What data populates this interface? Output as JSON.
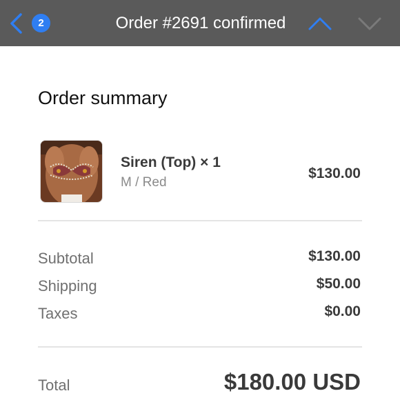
{
  "header": {
    "badge_count": "2",
    "title": "Order #2691 confirmed"
  },
  "summary": {
    "title": "Order summary"
  },
  "item": {
    "name": "Siren (Top) × 1",
    "variant": "M / Red",
    "price": "$130.00"
  },
  "totals": {
    "subtotal_label": "Subtotal",
    "subtotal_value": "$130.00",
    "shipping_label": "Shipping",
    "shipping_value": "$50.00",
    "taxes_label": "Taxes",
    "taxes_value": "$0.00",
    "total_label": "Total",
    "total_value": "$180.00 USD"
  },
  "colors": {
    "header_bg": "#5a5a5a",
    "accent": "#2f7ef2"
  }
}
